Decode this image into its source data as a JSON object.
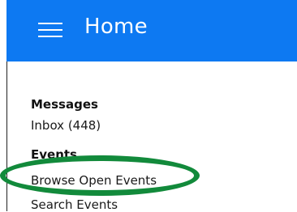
{
  "header": {
    "title": "Home",
    "menu_icon": "hamburger-menu-icon",
    "background_color": "#0d79f2"
  },
  "sections": {
    "messages": {
      "heading": "Messages",
      "inbox_label": "Inbox (448)"
    },
    "events": {
      "heading": "Events",
      "browse_label": "Browse Open Events",
      "search_label": "Search Events"
    }
  },
  "annotation": {
    "color": "#128a3b"
  }
}
